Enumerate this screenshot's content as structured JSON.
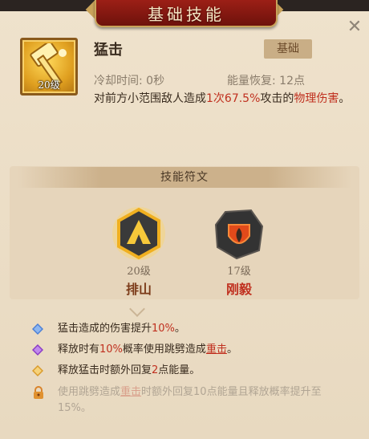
{
  "header": {
    "title": "基础技能"
  },
  "skill": {
    "name": "猛击",
    "type_badge": "基础",
    "level": "20级",
    "cooldown": "冷却时间: 0秒",
    "energy": "能量恢复: 12点",
    "desc_pre": "对前方小范围敌人造成",
    "desc_times": "1次",
    "desc_pct": "67.5%",
    "desc_mid": "攻击的",
    "desc_damage": "物理伤害",
    "desc_end": "。"
  },
  "runes": {
    "title": "技能符文",
    "items": [
      {
        "level": "20级",
        "name": "排山"
      },
      {
        "level": "17级",
        "name": "刚毅"
      }
    ]
  },
  "effects": [
    {
      "pre": "猛击造成的伤害提升",
      "hl": "10%",
      "post": "。"
    },
    {
      "pre": "释放时有",
      "hl": "10%",
      "mid": "概率使用跳劈造成",
      "ul": "重击",
      "post": "。"
    },
    {
      "pre": "释放猛击时额外回复",
      "hl": "2",
      "post": "点能量。"
    },
    {
      "pre": "使用跳劈造成",
      "ul": "重击",
      "post": "时额外回复10点能量且释放概率提升至15%。"
    }
  ],
  "colors": {
    "accent_red": "#c0301f",
    "banner": "#8c1a12",
    "gold": "#e0a020"
  },
  "icons": {
    "close": "close-icon",
    "skill": "hammer-icon",
    "rune1": "mountain-icon",
    "rune2": "shield-flame-icon",
    "gem1": "blue-gem-icon",
    "gem2": "purple-gem-icon",
    "gem3": "gold-gem-icon",
    "lock": "lock-icon"
  }
}
